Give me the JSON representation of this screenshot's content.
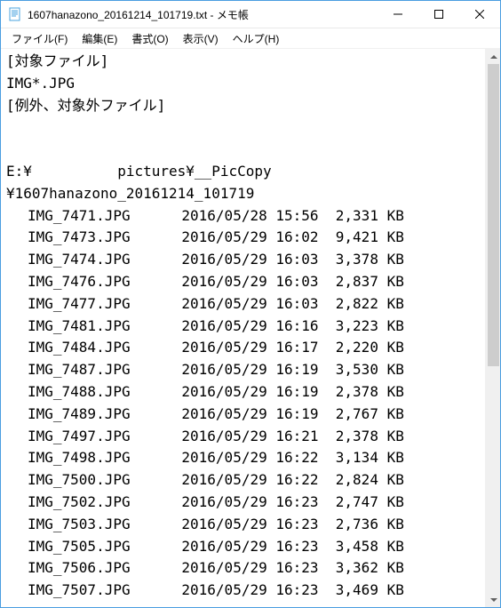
{
  "titlebar": {
    "title": "1607hanazono_20161214_101719.txt - メモ帳"
  },
  "menubar": {
    "file": "ファイル(F)",
    "edit": "編集(E)",
    "format": "書式(O)",
    "view": "表示(V)",
    "help": "ヘルプ(H)"
  },
  "content": {
    "header1": "[対象ファイル]",
    "header2": "IMG*.JPG",
    "header3": "[例外、対象外ファイル]",
    "path1": "E:¥          pictures¥__PicCopy",
    "path2": "¥1607hanazono_20161214_101719",
    "files": [
      {
        "name": "IMG_7471.JPG",
        "date": "2016/05/28 15:56",
        "size": "2,331 KB"
      },
      {
        "name": "IMG_7473.JPG",
        "date": "2016/05/29 16:02",
        "size": "9,421 KB"
      },
      {
        "name": "IMG_7474.JPG",
        "date": "2016/05/29 16:03",
        "size": "3,378 KB"
      },
      {
        "name": "IMG_7476.JPG",
        "date": "2016/05/29 16:03",
        "size": "2,837 KB"
      },
      {
        "name": "IMG_7477.JPG",
        "date": "2016/05/29 16:03",
        "size": "2,822 KB"
      },
      {
        "name": "IMG_7481.JPG",
        "date": "2016/05/29 16:16",
        "size": "3,223 KB"
      },
      {
        "name": "IMG_7484.JPG",
        "date": "2016/05/29 16:17",
        "size": "2,220 KB"
      },
      {
        "name": "IMG_7487.JPG",
        "date": "2016/05/29 16:19",
        "size": "3,530 KB"
      },
      {
        "name": "IMG_7488.JPG",
        "date": "2016/05/29 16:19",
        "size": "2,378 KB"
      },
      {
        "name": "IMG_7489.JPG",
        "date": "2016/05/29 16:19",
        "size": "2,767 KB"
      },
      {
        "name": "IMG_7497.JPG",
        "date": "2016/05/29 16:21",
        "size": "2,378 KB"
      },
      {
        "name": "IMG_7498.JPG",
        "date": "2016/05/29 16:22",
        "size": "3,134 KB"
      },
      {
        "name": "IMG_7500.JPG",
        "date": "2016/05/29 16:22",
        "size": "2,824 KB"
      },
      {
        "name": "IMG_7502.JPG",
        "date": "2016/05/29 16:23",
        "size": "2,747 KB"
      },
      {
        "name": "IMG_7503.JPG",
        "date": "2016/05/29 16:23",
        "size": "2,736 KB"
      },
      {
        "name": "IMG_7505.JPG",
        "date": "2016/05/29 16:23",
        "size": "3,458 KB"
      },
      {
        "name": "IMG_7506.JPG",
        "date": "2016/05/29 16:23",
        "size": "3,362 KB"
      },
      {
        "name": "IMG_7507.JPG",
        "date": "2016/05/29 16:23",
        "size": "3,469 KB"
      }
    ]
  }
}
